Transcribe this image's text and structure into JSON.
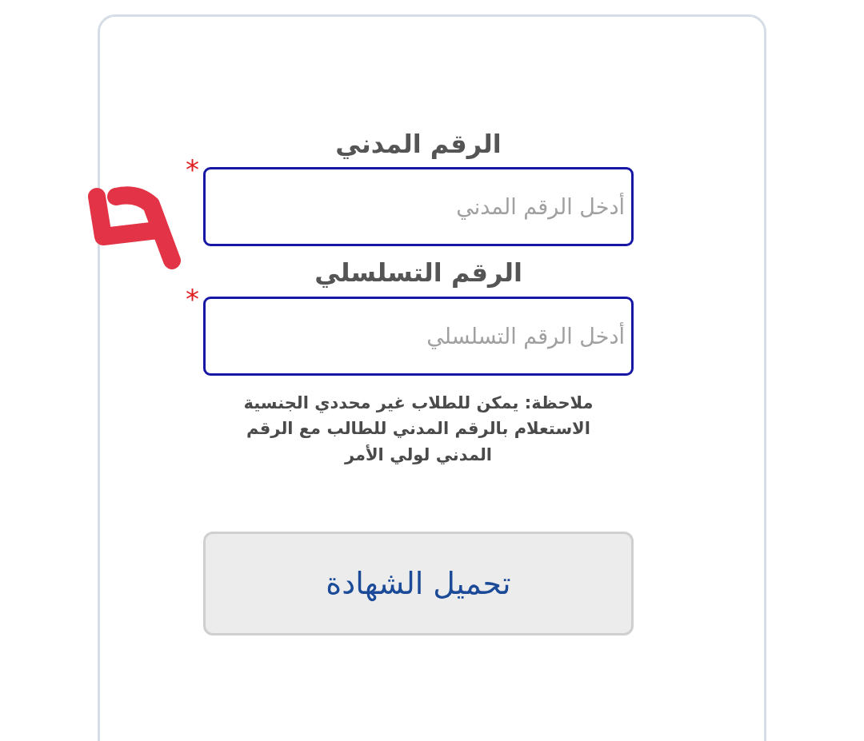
{
  "fields": [
    {
      "label": "الرقم المدني",
      "placeholder": "أدخل الرقم المدني",
      "required_mark": "*"
    },
    {
      "label": "الرقم التسلسلي",
      "placeholder": "أدخل الرقم التسلسلي",
      "required_mark": "*"
    }
  ],
  "note": "ملاحظة: يمكن للطلاب غير محددي الجنسية الاستعلام بالرقم المدني للطالب مع الرقم المدني لولي الأمر",
  "button": "تحميل الشهادة"
}
